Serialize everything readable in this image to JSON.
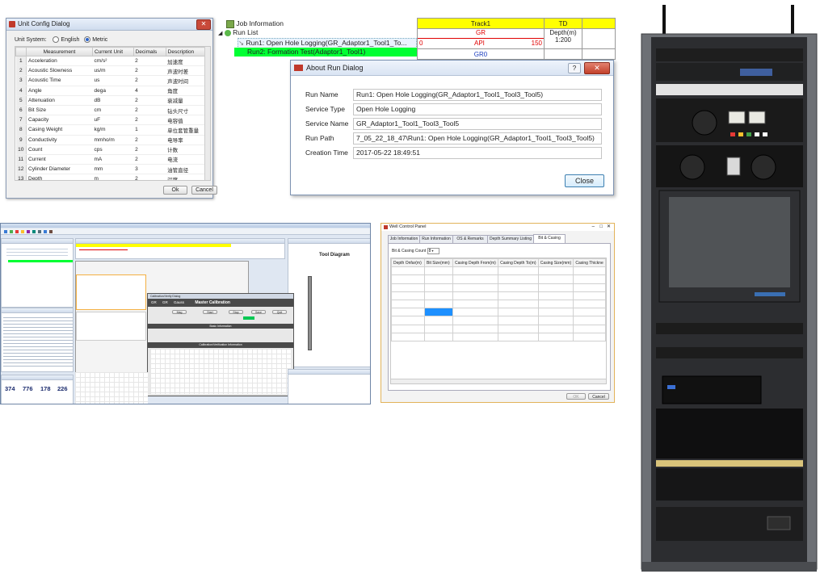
{
  "unit_config": {
    "title": "Unit Config Dialog",
    "unit_system_label": "Unit System:",
    "options": [
      "English",
      "Metric"
    ],
    "selected": "Metric",
    "columns": [
      "Measurement",
      "Current Unit",
      "Decimals",
      "Description"
    ],
    "rows": [
      [
        "1",
        "Acceleration",
        "cm/s²",
        "2",
        "加速度"
      ],
      [
        "2",
        "Acoustic Slowness",
        "us/m",
        "2",
        "声波时差"
      ],
      [
        "3",
        "Acoustic Time",
        "us",
        "2",
        "声波时间"
      ],
      [
        "4",
        "Angle",
        "dega",
        "4",
        "角度"
      ],
      [
        "5",
        "Attenuation",
        "dB",
        "2",
        "衰减量"
      ],
      [
        "6",
        "Bit Size",
        "cm",
        "2",
        "钻头尺寸"
      ],
      [
        "7",
        "Capacity",
        "uF",
        "2",
        "电容值"
      ],
      [
        "8",
        "Casing Weight",
        "kg/m",
        "1",
        "单位套管重量"
      ],
      [
        "9",
        "Conductivity",
        "mmho/m",
        "2",
        "电导率"
      ],
      [
        "10",
        "Count",
        "cps",
        "2",
        "计数"
      ],
      [
        "11",
        "Current",
        "mA",
        "2",
        "电流"
      ],
      [
        "12",
        "Cylinder Diameter",
        "mm",
        "3",
        "油管直径"
      ],
      [
        "13",
        "Depth",
        "m",
        "2",
        "深度"
      ]
    ],
    "ok": "Ok",
    "cancel": "Cancel"
  },
  "run_tree": {
    "job_info": "Job Information",
    "run_list": "Run List",
    "run1": "Run1: Open Hole Logging(GR_Adaptor1_Tool1_To...",
    "run2": "Run2: Formation Test(Adaptor1_Tool1)"
  },
  "track": {
    "track_name": "Track1",
    "td": "TD",
    "curve": "GR",
    "unit": "API",
    "min": "0",
    "max": "150",
    "depth_label": "Depth(m)",
    "scale": "1:200",
    "curve2": "GR0"
  },
  "about_run": {
    "title": "About Run Dialog",
    "help": "?",
    "fields": [
      {
        "label": "Run Name",
        "value": "Run1: Open Hole Logging(GR_Adaptor1_Tool1_Tool3_Tool5)"
      },
      {
        "label": "Service Type",
        "value": "Open Hole Logging"
      },
      {
        "label": "Service Name",
        "value": "GR_Adaptor1_Tool1_Tool3_Tool5"
      },
      {
        "label": "Run Path",
        "value": "7_05_22_18_47\\Run1: Open Hole Logging(GR_Adaptor1_Tool1_Tool3_Tool5)"
      },
      {
        "label": "Creation Time",
        "value": "2017-05-22 18:49:51"
      }
    ],
    "close": "Close"
  },
  "main_app": {
    "tool_diagram_title": "Tool Diagram",
    "calib_title": "Calibration/Verify Dialog",
    "master_calibration": "Master Calibration",
    "basic_information": "Basic Information",
    "calib_info": "Calibration/Verification Information",
    "calib_buttons": [
      "Mag",
      "Start",
      "Stop",
      "Save",
      "Quit"
    ],
    "tabs": [
      "GR",
      "GR",
      "Gauss"
    ],
    "counters": [
      "374",
      "776",
      "178",
      "226"
    ]
  },
  "well_control": {
    "title": "Well Control Panel",
    "tabs": [
      "Job Information",
      "Run Information",
      "OS & Remarks",
      "Depth Summary Listing",
      "Bit & Casing"
    ],
    "active_tab": "Bit & Casing",
    "count_label": "Bit & Casing Count",
    "count_value": "8",
    "columns": [
      "Depth Onfar(m)",
      "Bit Size(mm)",
      "Casing Depth From(m)",
      "Casing Depth To(m)",
      "Casing Size(mm)",
      "Casing Thickne"
    ],
    "ok": "OK",
    "cancel": "Cancel"
  },
  "colors": {
    "track_header": "#ffff00",
    "selected_run": "#00ff33",
    "curve_red": "#ff0000",
    "selected_cell": "#1e90ff",
    "well_panel_border": "#e2b35a"
  }
}
